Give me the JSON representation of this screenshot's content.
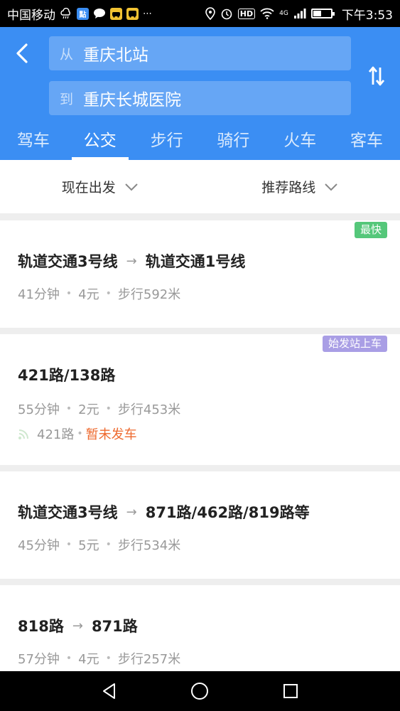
{
  "status_bar": {
    "carrier": "中国移动",
    "app_badge_1": "點",
    "network": "4G",
    "hd_label": "HD",
    "time": "下午3:53",
    "battery_level": 0.45
  },
  "search": {
    "from_prefix": "从",
    "from_value": "重庆北站",
    "to_prefix": "到",
    "to_value": "重庆长城医院"
  },
  "tabs": [
    {
      "label": "驾车",
      "active": false
    },
    {
      "label": "公交",
      "active": true
    },
    {
      "label": "步行",
      "active": false
    },
    {
      "label": "骑行",
      "active": false
    },
    {
      "label": "火车",
      "active": false
    },
    {
      "label": "客车",
      "active": false
    }
  ],
  "filters": {
    "departure": "现在出发",
    "strategy": "推荐路线"
  },
  "routes": [
    {
      "badge": "最快",
      "lines": [
        "轨道交通3号线",
        "轨道交通1号线"
      ],
      "duration": "41分钟",
      "fare": "4元",
      "walk": "步行592米"
    },
    {
      "badge": "始发站上车",
      "lines": [
        "421路/138路"
      ],
      "duration": "55分钟",
      "fare": "2元",
      "walk": "步行453米",
      "live_line": "421路",
      "live_status": "暂未发车"
    },
    {
      "lines": [
        "轨道交通3号线",
        "871路/462路/819路等"
      ],
      "duration": "45分钟",
      "fare": "5元",
      "walk": "步行534米"
    },
    {
      "lines": [
        "818路",
        "871路"
      ],
      "duration": "57分钟",
      "fare": "4元",
      "walk": "步行257米"
    }
  ],
  "colors": {
    "primary": "#3b8ef3",
    "fast_badge": "#55c77a",
    "start_badge": "#a99ee5",
    "status_orange": "#ee6a2f"
  }
}
